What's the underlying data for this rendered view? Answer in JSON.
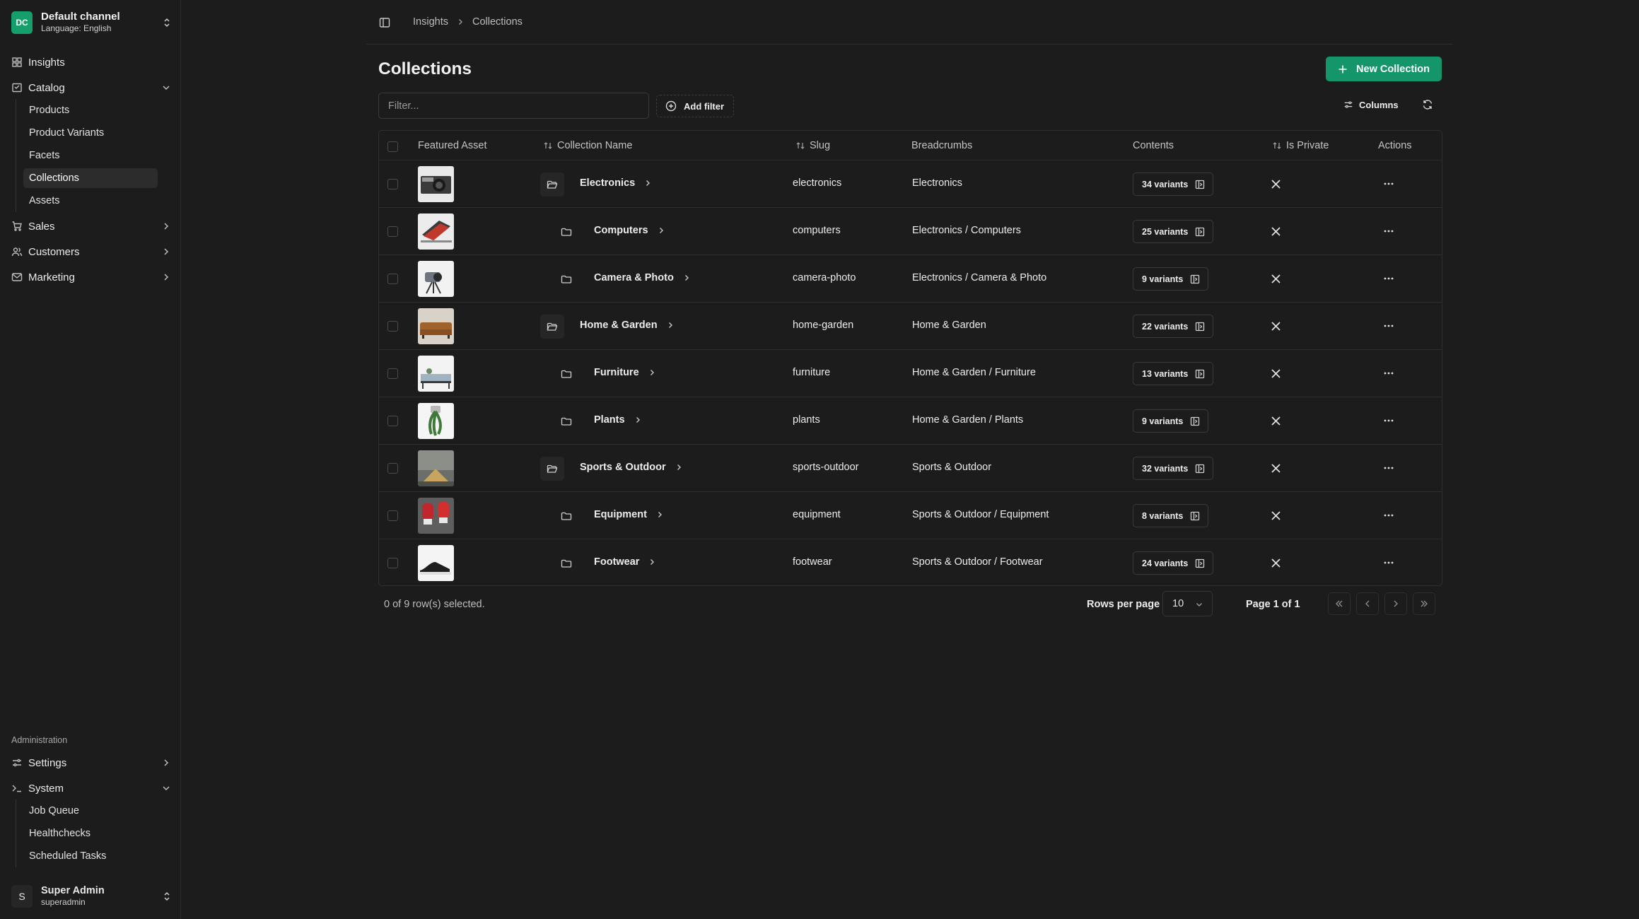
{
  "channel": {
    "badge": "DC",
    "name": "Default channel",
    "language": "Language: English"
  },
  "nav": {
    "insights": "Insights",
    "catalog": "Catalog",
    "catalog_items": [
      "Products",
      "Product Variants",
      "Facets",
      "Collections",
      "Assets"
    ],
    "sales": "Sales",
    "customers": "Customers",
    "marketing": "Marketing",
    "admin_section": "Administration",
    "settings": "Settings",
    "system": "System",
    "system_items": [
      "Job Queue",
      "Healthchecks",
      "Scheduled Tasks"
    ]
  },
  "user": {
    "initial": "S",
    "name": "Super Admin",
    "login": "superadmin"
  },
  "breadcrumb": [
    "Insights",
    "Collections"
  ],
  "page": {
    "title": "Collections",
    "new_button": "New Collection"
  },
  "toolbar": {
    "filter_placeholder": "Filter...",
    "add_filter": "Add filter",
    "columns": "Columns"
  },
  "table": {
    "headers": {
      "featured_asset": "Featured Asset",
      "collection_name": "Collection Name",
      "slug": "Slug",
      "breadcrumbs": "Breadcrumbs",
      "contents": "Contents",
      "is_private": "Is Private",
      "actions": "Actions"
    },
    "rows": [
      {
        "name": "Electronics",
        "slug": "electronics",
        "breadcrumbs": "Electronics",
        "contents": "34 variants",
        "level": 0,
        "thumb": "camera"
      },
      {
        "name": "Computers",
        "slug": "computers",
        "breadcrumbs": "Electronics / Computers",
        "contents": "25 variants",
        "level": 1,
        "thumb": "laptop"
      },
      {
        "name": "Camera & Photo",
        "slug": "camera-photo",
        "breadcrumbs": "Electronics / Camera & Photo",
        "contents": "9 variants",
        "level": 1,
        "thumb": "tripod"
      },
      {
        "name": "Home & Garden",
        "slug": "home-garden",
        "breadcrumbs": "Home & Garden",
        "contents": "22 variants",
        "level": 0,
        "thumb": "sofa"
      },
      {
        "name": "Furniture",
        "slug": "furniture",
        "breadcrumbs": "Home & Garden / Furniture",
        "contents": "13 variants",
        "level": 1,
        "thumb": "bench"
      },
      {
        "name": "Plants",
        "slug": "plants",
        "breadcrumbs": "Home & Garden / Plants",
        "contents": "9 variants",
        "level": 1,
        "thumb": "plant"
      },
      {
        "name": "Sports & Outdoor",
        "slug": "sports-outdoor",
        "breadcrumbs": "Sports & Outdoor",
        "contents": "32 variants",
        "level": 0,
        "thumb": "tent"
      },
      {
        "name": "Equipment",
        "slug": "equipment",
        "breadcrumbs": "Sports & Outdoor / Equipment",
        "contents": "8 variants",
        "level": 1,
        "thumb": "gloves"
      },
      {
        "name": "Footwear",
        "slug": "footwear",
        "breadcrumbs": "Sports & Outdoor / Footwear",
        "contents": "24 variants",
        "level": 1,
        "thumb": "shoe"
      }
    ]
  },
  "footer": {
    "selection": "0 of 9 row(s) selected.",
    "rows_per_page_label": "Rows per page",
    "rows_per_page_value": "10",
    "page_info": "Page 1 of 1"
  },
  "colors": {
    "accent": "#14956a",
    "background": "#1c1c1c",
    "border": "#2f2f2f"
  }
}
